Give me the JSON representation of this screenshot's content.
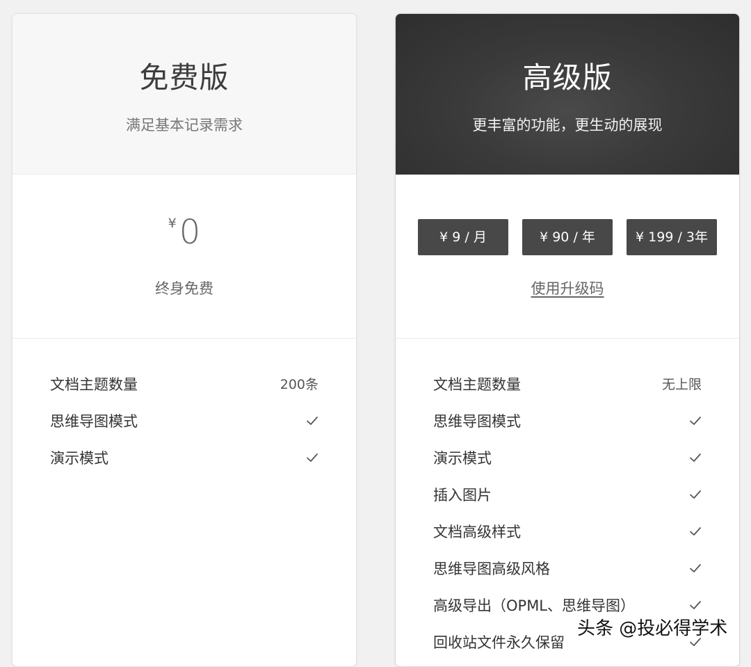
{
  "free_plan": {
    "title": "免费版",
    "subtitle": "满足基本记录需求",
    "currency": "¥",
    "price": "0",
    "price_note": "终身免费",
    "features": [
      {
        "label": "文档主题数量",
        "value": "200条"
      },
      {
        "label": "思维导图模式",
        "value": "check"
      },
      {
        "label": "演示模式",
        "value": "check"
      }
    ]
  },
  "premium_plan": {
    "title": "高级版",
    "subtitle": "更丰富的功能，更生动的展现",
    "price_buttons": [
      "¥ 9 / 月",
      "¥ 90 / 年",
      "¥ 199 / 3年"
    ],
    "upgrade_code_link": "使用升级码",
    "features": [
      {
        "label": "文档主题数量",
        "value": "无上限"
      },
      {
        "label": "思维导图模式",
        "value": "check"
      },
      {
        "label": "演示模式",
        "value": "check"
      },
      {
        "label": "插入图片",
        "value": "check"
      },
      {
        "label": "文档高级样式",
        "value": "check"
      },
      {
        "label": "思维导图高级风格",
        "value": "check"
      },
      {
        "label": "高级导出（OPML、思维导图）",
        "value": "check"
      },
      {
        "label": "回收站文件永久保留",
        "value": "check"
      }
    ]
  },
  "watermark": "头条 @投必得学术",
  "colors": {
    "premium_header": "#333333",
    "price_button": "#484848",
    "page_background": "#f1f1f1"
  }
}
